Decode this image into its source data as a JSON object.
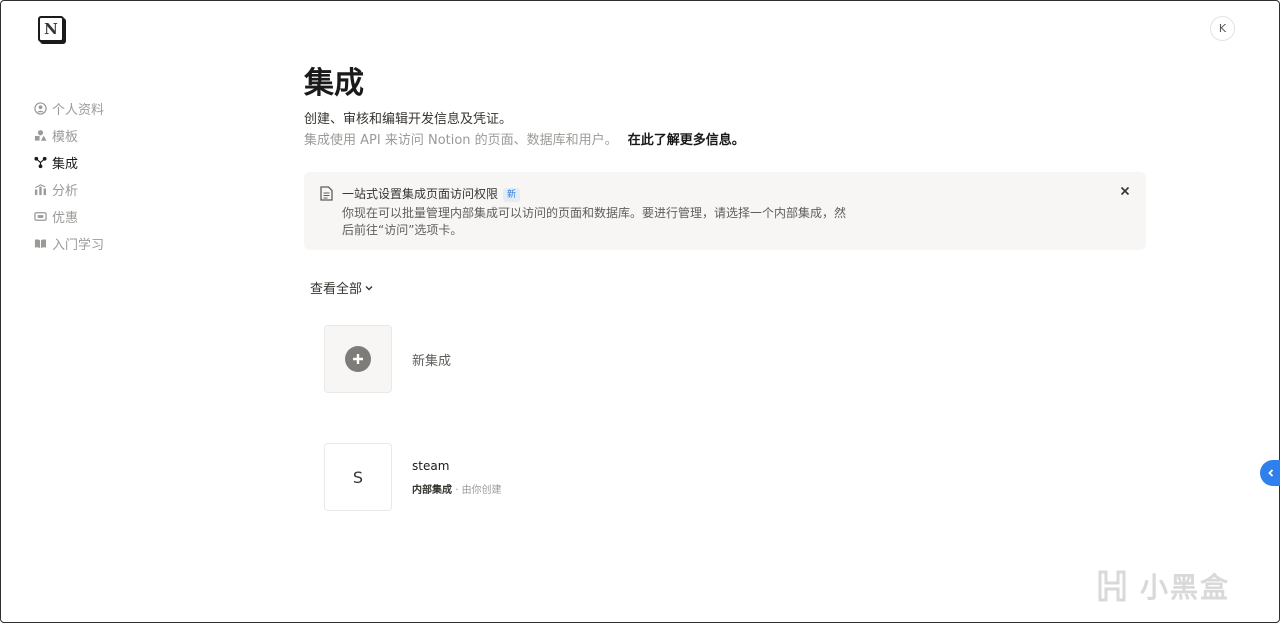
{
  "app": {
    "logo_letter": "N",
    "avatar_initial": "K"
  },
  "sidebar": {
    "items": [
      {
        "label": "个人资料",
        "icon": "user-circle-icon",
        "active": false
      },
      {
        "label": "模板",
        "icon": "shapes-icon",
        "active": false
      },
      {
        "label": "集成",
        "icon": "integration-icon",
        "active": true
      },
      {
        "label": "分析",
        "icon": "analytics-icon",
        "active": false
      },
      {
        "label": "优惠",
        "icon": "ticket-icon",
        "active": false
      },
      {
        "label": "入门学习",
        "icon": "book-icon",
        "active": false
      }
    ]
  },
  "main": {
    "title": "集成",
    "subtitle": "创建、审核和编辑开发信息及凭证。",
    "description": "集成使用 API 来访问 Notion 的页面、数据库和用户。",
    "learn_more": "在此了解更多信息。"
  },
  "callout": {
    "title": "一站式设置集成页面访问权限",
    "badge": "新",
    "body": "你现在可以批量管理内部集成可以访问的页面和数据库。要进行管理，请选择一个内部集成，然后前往“访问”选项卡。"
  },
  "filter": {
    "label": "查看全部"
  },
  "new_integration": {
    "label": "新集成"
  },
  "integrations": [
    {
      "initial": "S",
      "name": "steam",
      "type": "内部集成",
      "separator": "·",
      "creator": "由你创建"
    }
  ],
  "watermark": {
    "text": "小黑盒"
  },
  "colors": {
    "accent": "#2f80ed",
    "text": "#37352f",
    "muted": "#9b9a97",
    "callout_bg": "#f7f6f4"
  }
}
